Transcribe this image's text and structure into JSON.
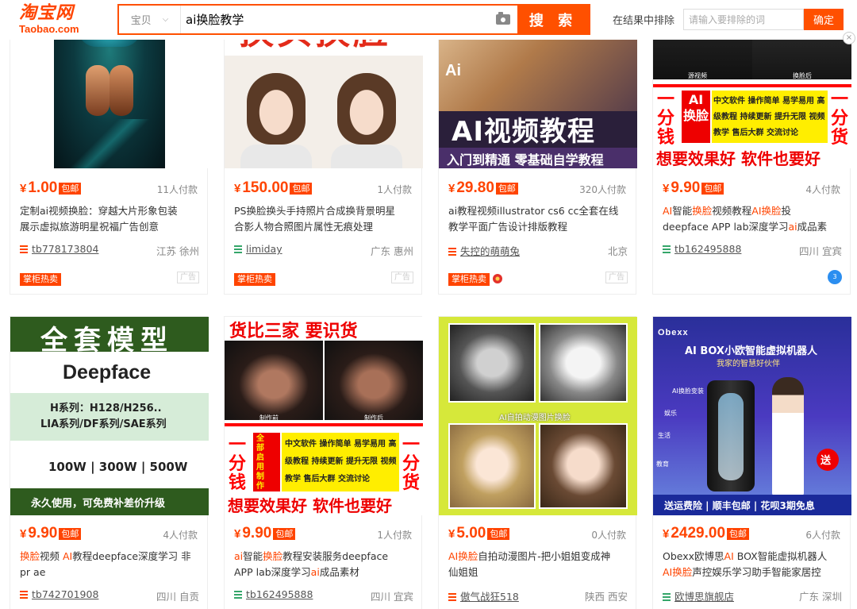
{
  "header": {
    "logo_main": "淘宝网",
    "logo_sub": "Taobao.com",
    "search_category": "宝贝",
    "search_value": "ai换脸教学",
    "search_button": "搜 索",
    "exclude_label": "在结果中排除",
    "exclude_placeholder": "请输入要排除的词",
    "exclude_button": "确定",
    "close_label": "×"
  },
  "colors": {
    "accent": "#ff5000",
    "price": "#ff4400",
    "shop_green": "#35a66a"
  },
  "products": [
    {
      "price_symbol": "¥",
      "price": "1.00",
      "badge": "包邮",
      "sold": "11人付款",
      "title_line1": [
        {
          "t": "定制ai视频换脸：穿越大片形象包装",
          "h": false
        }
      ],
      "title_line2": [
        {
          "t": "展示虚拟旅游明星祝福广告创意",
          "h": false
        }
      ],
      "shop": "tb778173804",
      "shop_icon": "shop-icon-orange",
      "location": "江苏 徐州",
      "tag": "掌柜热卖",
      "ad": "广告"
    },
    {
      "price_symbol": "¥",
      "price": "150.00",
      "badge": "包邮",
      "sold": "1人付款",
      "title_line1": [
        {
          "t": "PS换脸换头手持照片合成换背景明星",
          "h": false
        }
      ],
      "title_line2": [
        {
          "t": "合影人物合照图片属性无痕处理",
          "h": false
        }
      ],
      "shop": "limiday",
      "shop_icon": "shop-icon-green",
      "location": "广东 惠州",
      "tag": "掌柜热卖",
      "ad": "广告",
      "img_text": "换头换脸"
    },
    {
      "price_symbol": "¥",
      "price": "29.80",
      "badge": "包邮",
      "sold": "320人付款",
      "title_line1": [
        {
          "t": "ai教程视频illustrator cs6 cc全套在线",
          "h": false
        }
      ],
      "title_line2": [
        {
          "t": "教学平面广告设计排版教程",
          "h": false
        }
      ],
      "shop": "失控的萌萌兔",
      "shop_icon": "shop-icon-orange",
      "location": "北京",
      "tag": "掌柜热卖",
      "ad": "广告",
      "img_text_main": "AI视频教程",
      "img_text_sub": "入门到精通  零基础自学教程",
      "img_text_logo": "Ai"
    },
    {
      "price_symbol": "¥",
      "price": "9.90",
      "badge": "包邮",
      "sold": "4人付款",
      "title_line1": [
        {
          "t": "AI",
          "h": true
        },
        {
          "t": "智能",
          "h": false
        },
        {
          "t": "换脸",
          "h": true
        },
        {
          "t": "视频教程",
          "h": false
        },
        {
          "t": "AI换脸",
          "h": true
        },
        {
          "t": "投",
          "h": false
        }
      ],
      "title_line2": [
        {
          "t": "deepface APP lab深度学习",
          "h": false
        },
        {
          "t": "ai",
          "h": true
        },
        {
          "t": "成品素",
          "h": false
        }
      ],
      "shop": "tb162495888",
      "shop_icon": "shop-icon-green",
      "location": "四川 宜宾",
      "bubble": "3",
      "img_left": "一分钱",
      "img_right": "一分货",
      "img_ai": "AI换脸",
      "img_features": "中文软件 操作简单 易学易用 高级教程 持续更新 提升无限 视频教学 售后大群 交流讨论",
      "img_bottom": "想要效果好 软件也要好",
      "img_cap_l": "源视频",
      "img_cap_r": "换脸后"
    },
    {
      "price_symbol": "¥",
      "price": "9.90",
      "badge": "包邮",
      "sold": "4人付款",
      "title_line1": [
        {
          "t": "换脸",
          "h": true
        },
        {
          "t": "视频 ",
          "h": false
        },
        {
          "t": "AI",
          "h": true
        },
        {
          "t": "教程deepface深度学习 非",
          "h": false
        }
      ],
      "title_line2": [
        {
          "t": "pr ae",
          "h": false
        }
      ],
      "shop": "tb742701908",
      "shop_icon": "shop-icon-orange",
      "location": "四川 自贡",
      "img_title": "全套模型",
      "img_brand": "Deepface",
      "img_series1": "H系列：H128/H256..",
      "img_series2": "LIA系列/DF系列/SAE系列",
      "img_sizes": "100W | 300W | 500W",
      "img_footer": "永久使用，可免费补差价升级"
    },
    {
      "price_symbol": "¥",
      "price": "9.90",
      "badge": "包邮",
      "sold": "1人付款",
      "title_line1": [
        {
          "t": "ai",
          "h": true
        },
        {
          "t": "智能",
          "h": false
        },
        {
          "t": "换脸",
          "h": true
        },
        {
          "t": "教程安装服务deepface",
          "h": false
        }
      ],
      "title_line2": [
        {
          "t": "APP lab深度学习",
          "h": false
        },
        {
          "t": "ai",
          "h": true
        },
        {
          "t": "成品素材",
          "h": false
        }
      ],
      "shop": "tb162495888",
      "shop_icon": "shop-icon-green",
      "location": "四川 宜宾",
      "img_top": "货比三家 要识货",
      "img_cap_l": "制作前",
      "img_cap_r": "制作后",
      "img_left": "一分钱",
      "img_right": "一分货",
      "img_mid": "全部启用制作",
      "img_features": "中文软件 操作简单 易学易用 高级教程 持续更新 提升无限 视频教学 售后大群 交流讨论",
      "img_bottom": "想要效果好 软件也要好"
    },
    {
      "price_symbol": "¥",
      "price": "5.00",
      "badge": "包邮",
      "sold": "0人付款",
      "title_line1": [
        {
          "t": "AI换脸",
          "h": true
        },
        {
          "t": "自拍动漫图片-把小姐姐变成神",
          "h": false
        }
      ],
      "title_line2": [
        {
          "t": "仙姐姐",
          "h": false
        }
      ],
      "shop": "傲气战狂518",
      "shop_icon": "shop-icon-orange",
      "location": "陕西 西安",
      "img_caption": "AI自拍动漫图片换脸"
    },
    {
      "price_symbol": "¥",
      "price": "2429.00",
      "badge": "包邮",
      "sold": "6人付款",
      "title_line1": [
        {
          "t": "Obexx欧博思",
          "h": false
        },
        {
          "t": "AI",
          "h": true
        },
        {
          "t": " BOX智能虚拟机器人",
          "h": false
        }
      ],
      "title_line2": [
        {
          "t": "AI换脸",
          "h": true
        },
        {
          "t": "声控娱乐学习助手智能家居控",
          "h": false
        }
      ],
      "shop": "欧博思旗舰店",
      "shop_icon": "shop-icon-green",
      "location": "广东 深圳",
      "img_brand": "Obexx",
      "img_title": "AI BOX小欧智能虚拟机器人",
      "img_sub": "我家的智慧好伙伴",
      "img_labels": [
        "AI换脸变装",
        "娱乐",
        "生活",
        "教育"
      ],
      "img_send": "送",
      "img_bottom": "送运费险 | 顺丰包邮 | 花呗3期免息"
    }
  ]
}
